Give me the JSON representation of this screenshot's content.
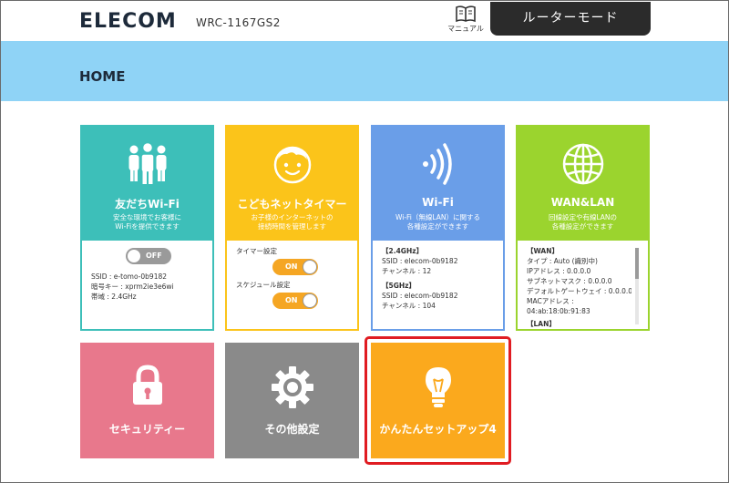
{
  "header": {
    "brand": "ELECOM",
    "model": "WRC-1167GS2",
    "manual_label": "マニュアル",
    "mode_label": "ルーターモード",
    "page_title": "HOME",
    "colors": {
      "header_bg": "#8fd3f6",
      "mode_bg": "#2b2b2b"
    }
  },
  "tiles": {
    "friend_wifi": {
      "icon": "people-icon",
      "title": "友だちWi-Fi",
      "desc1": "安全な環境でお客様に",
      "desc2": "Wi-Fiを提供できます",
      "toggle": "OFF",
      "ssid": "SSID : e-tomo-0b9182",
      "key": "暗号キー : xprm2ie3e6wi",
      "band": "帯域 : 2.4GHz",
      "color": "#3dbfb9"
    },
    "kids_timer": {
      "icon": "child-face-icon",
      "title": "こどもネットタイマー",
      "desc1": "お子様のインターネットの",
      "desc2": "接続時間を管理します",
      "timer_label": "タイマー設定",
      "timer_toggle": "ON",
      "schedule_label": "スケジュール設定",
      "schedule_toggle": "ON",
      "color": "#fbc41a"
    },
    "wifi": {
      "icon": "wifi-signal-icon",
      "title": "Wi-Fi",
      "desc1": "Wi-Fi（無線LAN）に関する",
      "desc2": "各種設定ができます",
      "band24_head": "【2.4GHz】",
      "band24_ssid": "SSID : elecom-0b9182",
      "band24_channel": "チャンネル : 12",
      "band5_head": "【5GHz】",
      "band5_ssid": "SSID : elecom-0b9182",
      "band5_channel": "チャンネル : 104",
      "color": "#6a9ee8"
    },
    "wan_lan": {
      "icon": "globe-icon",
      "title": "WAN&LAN",
      "desc1": "回線設定や有線LANの",
      "desc2": "各種設定ができます",
      "wan_head": "【WAN】",
      "type": "タイプ : Auto (識別中)",
      "ip": "IPアドレス : 0.0.0.0",
      "subnet": "サブネットマスク : 0.0.0.0",
      "gateway": "デフォルトゲートウェイ : 0.0.0.0",
      "mac_label": "MACアドレス :",
      "mac": "04:ab:18:0b:91:83",
      "lan_head": "【LAN】",
      "color": "#9bd42e"
    }
  },
  "buttons": {
    "security": {
      "icon": "lock-icon",
      "label": "セキュリティー",
      "color": "#e8788c"
    },
    "other": {
      "icon": "gear-icon",
      "label": "その他設定",
      "color": "#8a8a8a"
    },
    "setup": {
      "icon": "light-bulb-icon",
      "label": "かんたんセットアップ4",
      "color": "#fba91d"
    }
  }
}
